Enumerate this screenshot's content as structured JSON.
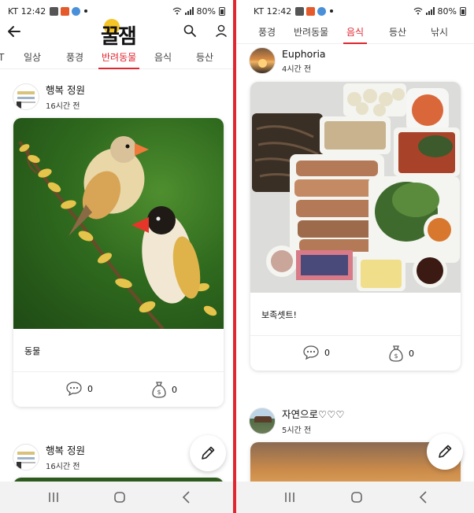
{
  "status_bar": {
    "carrier": "KT",
    "time": "12:42",
    "battery": "80%"
  },
  "app": {
    "logo_text": "꿀잼"
  },
  "left_screen": {
    "tabs": [
      {
        "label": "T"
      },
      {
        "label": "일상"
      },
      {
        "label": "풍경"
      },
      {
        "label": "반려동물",
        "active": true
      },
      {
        "label": "음식"
      },
      {
        "label": "등산"
      }
    ],
    "posts": [
      {
        "author": "행복 정원",
        "time": "16시간 전",
        "caption": "동물",
        "comments": "0",
        "donations": "0",
        "image": "two finches on a branch"
      },
      {
        "author": "행복 정원",
        "time": "16시간 전"
      }
    ]
  },
  "right_screen": {
    "tabs": [
      {
        "label": "풍경"
      },
      {
        "label": "반려동물"
      },
      {
        "label": "음식",
        "active": true
      },
      {
        "label": "등산"
      },
      {
        "label": "낚시"
      }
    ],
    "posts": [
      {
        "author": "Euphoria",
        "time": "4시간 전",
        "caption": "보족셋트!",
        "comments": "0",
        "donations": "0",
        "image": "bossam platter with side dishes"
      },
      {
        "author": "자연으로♡♡♡",
        "time": "5시간 전",
        "image": "fried food"
      }
    ]
  },
  "icons": {
    "back": "arrow-left-icon",
    "search": "search-icon",
    "user": "user-icon",
    "comment": "comment-bubble-icon",
    "donation": "money-bag-icon",
    "write": "pencil-icon",
    "recents": "recents-icon",
    "home": "home-icon",
    "nav_back": "nav-back-icon"
  },
  "colors": {
    "accent": "#e0262f",
    "divider": "#e0262f",
    "logo_sun": "#f5c527"
  }
}
